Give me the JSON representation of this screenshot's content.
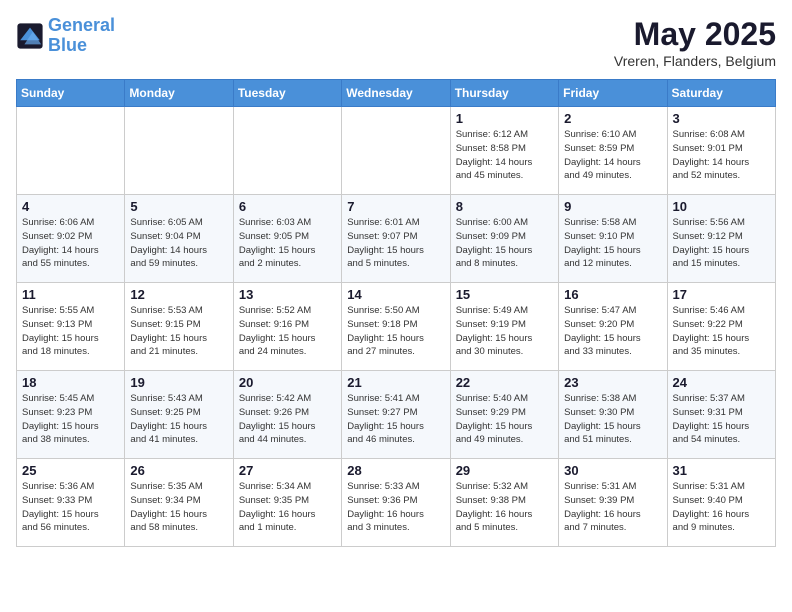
{
  "header": {
    "logo_line1": "General",
    "logo_line2": "Blue",
    "month": "May 2025",
    "location": "Vreren, Flanders, Belgium"
  },
  "weekdays": [
    "Sunday",
    "Monday",
    "Tuesday",
    "Wednesday",
    "Thursday",
    "Friday",
    "Saturday"
  ],
  "weeks": [
    [
      {
        "day": "",
        "info": ""
      },
      {
        "day": "",
        "info": ""
      },
      {
        "day": "",
        "info": ""
      },
      {
        "day": "",
        "info": ""
      },
      {
        "day": "1",
        "info": "Sunrise: 6:12 AM\nSunset: 8:58 PM\nDaylight: 14 hours\nand 45 minutes."
      },
      {
        "day": "2",
        "info": "Sunrise: 6:10 AM\nSunset: 8:59 PM\nDaylight: 14 hours\nand 49 minutes."
      },
      {
        "day": "3",
        "info": "Sunrise: 6:08 AM\nSunset: 9:01 PM\nDaylight: 14 hours\nand 52 minutes."
      }
    ],
    [
      {
        "day": "4",
        "info": "Sunrise: 6:06 AM\nSunset: 9:02 PM\nDaylight: 14 hours\nand 55 minutes."
      },
      {
        "day": "5",
        "info": "Sunrise: 6:05 AM\nSunset: 9:04 PM\nDaylight: 14 hours\nand 59 minutes."
      },
      {
        "day": "6",
        "info": "Sunrise: 6:03 AM\nSunset: 9:05 PM\nDaylight: 15 hours\nand 2 minutes."
      },
      {
        "day": "7",
        "info": "Sunrise: 6:01 AM\nSunset: 9:07 PM\nDaylight: 15 hours\nand 5 minutes."
      },
      {
        "day": "8",
        "info": "Sunrise: 6:00 AM\nSunset: 9:09 PM\nDaylight: 15 hours\nand 8 minutes."
      },
      {
        "day": "9",
        "info": "Sunrise: 5:58 AM\nSunset: 9:10 PM\nDaylight: 15 hours\nand 12 minutes."
      },
      {
        "day": "10",
        "info": "Sunrise: 5:56 AM\nSunset: 9:12 PM\nDaylight: 15 hours\nand 15 minutes."
      }
    ],
    [
      {
        "day": "11",
        "info": "Sunrise: 5:55 AM\nSunset: 9:13 PM\nDaylight: 15 hours\nand 18 minutes."
      },
      {
        "day": "12",
        "info": "Sunrise: 5:53 AM\nSunset: 9:15 PM\nDaylight: 15 hours\nand 21 minutes."
      },
      {
        "day": "13",
        "info": "Sunrise: 5:52 AM\nSunset: 9:16 PM\nDaylight: 15 hours\nand 24 minutes."
      },
      {
        "day": "14",
        "info": "Sunrise: 5:50 AM\nSunset: 9:18 PM\nDaylight: 15 hours\nand 27 minutes."
      },
      {
        "day": "15",
        "info": "Sunrise: 5:49 AM\nSunset: 9:19 PM\nDaylight: 15 hours\nand 30 minutes."
      },
      {
        "day": "16",
        "info": "Sunrise: 5:47 AM\nSunset: 9:20 PM\nDaylight: 15 hours\nand 33 minutes."
      },
      {
        "day": "17",
        "info": "Sunrise: 5:46 AM\nSunset: 9:22 PM\nDaylight: 15 hours\nand 35 minutes."
      }
    ],
    [
      {
        "day": "18",
        "info": "Sunrise: 5:45 AM\nSunset: 9:23 PM\nDaylight: 15 hours\nand 38 minutes."
      },
      {
        "day": "19",
        "info": "Sunrise: 5:43 AM\nSunset: 9:25 PM\nDaylight: 15 hours\nand 41 minutes."
      },
      {
        "day": "20",
        "info": "Sunrise: 5:42 AM\nSunset: 9:26 PM\nDaylight: 15 hours\nand 44 minutes."
      },
      {
        "day": "21",
        "info": "Sunrise: 5:41 AM\nSunset: 9:27 PM\nDaylight: 15 hours\nand 46 minutes."
      },
      {
        "day": "22",
        "info": "Sunrise: 5:40 AM\nSunset: 9:29 PM\nDaylight: 15 hours\nand 49 minutes."
      },
      {
        "day": "23",
        "info": "Sunrise: 5:38 AM\nSunset: 9:30 PM\nDaylight: 15 hours\nand 51 minutes."
      },
      {
        "day": "24",
        "info": "Sunrise: 5:37 AM\nSunset: 9:31 PM\nDaylight: 15 hours\nand 54 minutes."
      }
    ],
    [
      {
        "day": "25",
        "info": "Sunrise: 5:36 AM\nSunset: 9:33 PM\nDaylight: 15 hours\nand 56 minutes."
      },
      {
        "day": "26",
        "info": "Sunrise: 5:35 AM\nSunset: 9:34 PM\nDaylight: 15 hours\nand 58 minutes."
      },
      {
        "day": "27",
        "info": "Sunrise: 5:34 AM\nSunset: 9:35 PM\nDaylight: 16 hours\nand 1 minute."
      },
      {
        "day": "28",
        "info": "Sunrise: 5:33 AM\nSunset: 9:36 PM\nDaylight: 16 hours\nand 3 minutes."
      },
      {
        "day": "29",
        "info": "Sunrise: 5:32 AM\nSunset: 9:38 PM\nDaylight: 16 hours\nand 5 minutes."
      },
      {
        "day": "30",
        "info": "Sunrise: 5:31 AM\nSunset: 9:39 PM\nDaylight: 16 hours\nand 7 minutes."
      },
      {
        "day": "31",
        "info": "Sunrise: 5:31 AM\nSunset: 9:40 PM\nDaylight: 16 hours\nand 9 minutes."
      }
    ]
  ]
}
